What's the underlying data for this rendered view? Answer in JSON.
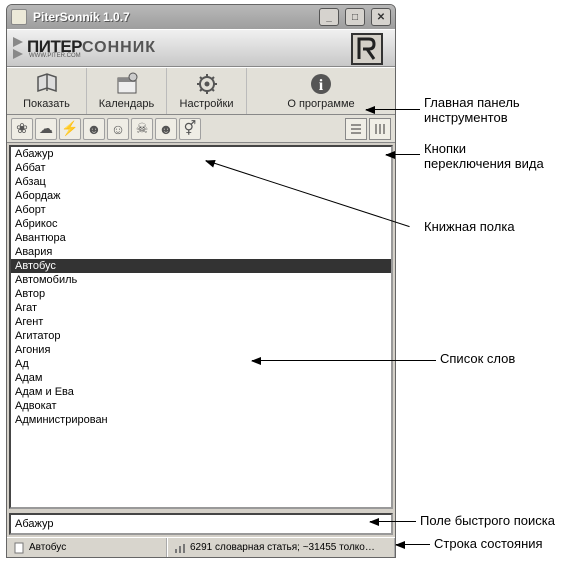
{
  "window": {
    "title": "PiterSonnik 1.0.7"
  },
  "banner": {
    "brand_piter": "ПИТЕР",
    "brand_sonnik": "СОННИК",
    "brand_sub": "WWW.PITER.COM"
  },
  "toolbar": {
    "show": "Показать",
    "calendar": "Календарь",
    "settings": "Настройки",
    "about": "О программе"
  },
  "shelf_icons": [
    "tulip-icon",
    "cloud-icon",
    "storm-icon",
    "head1-icon",
    "head2-icon",
    "skull-icon",
    "head3-icon",
    "gender-icon"
  ],
  "words": [
    {
      "label": "Абажур",
      "selected": false
    },
    {
      "label": "Аббат",
      "selected": false
    },
    {
      "label": "Абзац",
      "selected": false
    },
    {
      "label": "Абордаж",
      "selected": false
    },
    {
      "label": "Аборт",
      "selected": false
    },
    {
      "label": "Абрикос",
      "selected": false
    },
    {
      "label": "Авантюра",
      "selected": false
    },
    {
      "label": "Авария",
      "selected": false
    },
    {
      "label": "Автобус",
      "selected": true
    },
    {
      "label": "Автомобиль",
      "selected": false
    },
    {
      "label": "Автор",
      "selected": false
    },
    {
      "label": "Агат",
      "selected": false
    },
    {
      "label": "Агент",
      "selected": false
    },
    {
      "label": "Агитатор",
      "selected": false
    },
    {
      "label": "Агония",
      "selected": false
    },
    {
      "label": "Ад",
      "selected": false
    },
    {
      "label": "Адам",
      "selected": false
    },
    {
      "label": "Адам и Ева",
      "selected": false
    },
    {
      "label": "Адвокат",
      "selected": false
    },
    {
      "label": "Администрирован",
      "selected": false
    }
  ],
  "search": {
    "value": "Абажур"
  },
  "status": {
    "current": "Автобус",
    "stats": "6291 словарная статья;  ~31455 толко…"
  },
  "callouts": {
    "main_toolbar": "Главная панель\nинструментов",
    "view_buttons": "Кнопки\nпереключения вида",
    "shelf": "Книжная полка",
    "wordlist": "Список слов",
    "search": "Поле быстрого поиска",
    "status": "Строка состояния"
  }
}
